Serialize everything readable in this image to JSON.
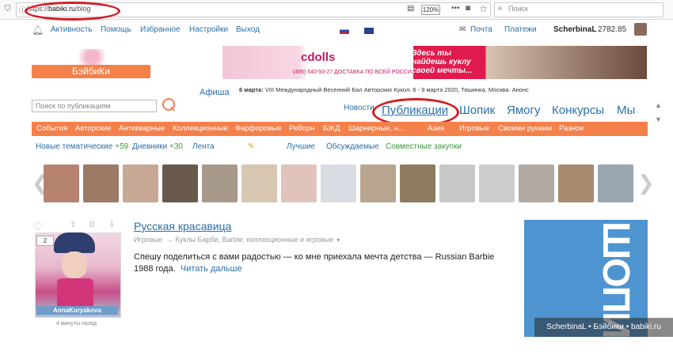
{
  "browser": {
    "url_prefix": "https://",
    "url_domain": "babiki.ru",
    "url_path": "/blog",
    "zoom": "120%",
    "search_placeholder": "Поиск",
    "dots": "•••"
  },
  "topnav": {
    "activity": "Активность",
    "help": "Помощь",
    "favorites": "Избранное",
    "settings": "Настройки",
    "logout": "Выход",
    "mail": "Почта",
    "payments": "Платежи",
    "user": "ScherbinaL",
    "balance": "2782.85"
  },
  "logo": {
    "text": "БэйбиКи"
  },
  "banner": {
    "brand": "cdolls",
    "phone": "(495) 540-50-27  ДОСТАВКА ПО ВСЕЙ РОССИИ",
    "slogan": "Здесь ты найдешь куклу своей мечты..."
  },
  "afisha": {
    "label": "Афиша",
    "date": "6 марта:",
    "event": "VIII Международный Весенний Бал Авторских Кукол. 6 - 9 марта 2020, Тишинка, Москва. Анонс"
  },
  "search": {
    "placeholder": "Поиск по публикациям"
  },
  "mainnav": {
    "news": "Новости",
    "publications": "Публикации",
    "shop": "Шопик",
    "yamogu": "Ямогу",
    "contests": "Конкурсы",
    "we": "Мы"
  },
  "categories": [
    "События",
    "Авторские",
    "Антикварные",
    "Коллекционные",
    "Фарфоровые",
    "Реборн",
    "БЖД",
    "Шарнирные, н...",
    "Азия",
    "Игровые",
    "Своими руками",
    "Разное"
  ],
  "submenu": {
    "new_themes": "Новые тематические",
    "new_count": "+59",
    "diaries": "Дневники",
    "diaries_count": "+30",
    "feed": "Лента",
    "best": "Лучшие",
    "discussed": "Обсуждаемые",
    "joint": "Совместные закупки"
  },
  "post": {
    "title": "Русская красавица",
    "category": "Игровые",
    "subcategory": "→ Куклы Барби, Barbie: коллекционные и игровые",
    "text": "Спешу поделиться с вами радостью — ко мне приехала мечта детства — Russian Barbie 1988 года.",
    "more": "Читать дальше",
    "comments": "2",
    "author": "AnnaKoryakova",
    "time": "4 минуты назад"
  },
  "side_banner": {
    "text": "ШОПИК"
  },
  "watermark": "ScherbinaL • Бэйбики • babiki.ru",
  "colors": {
    "accent": "#f4804a",
    "link": "#2a6fa8",
    "annotation": "#d21b24"
  }
}
